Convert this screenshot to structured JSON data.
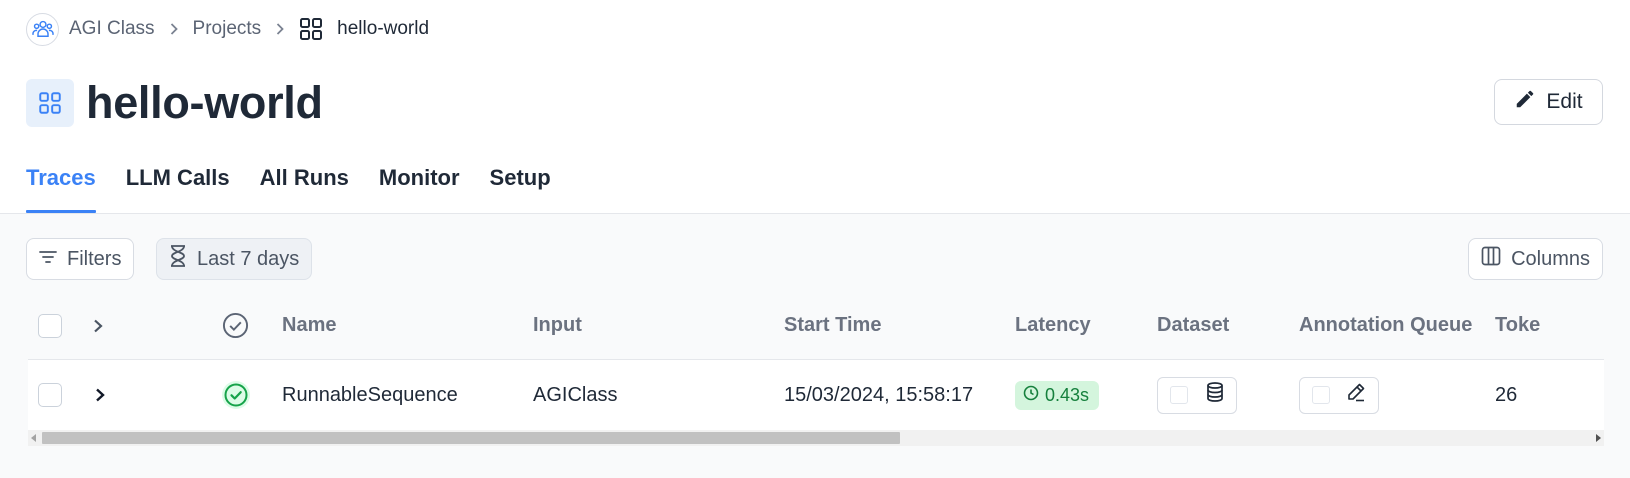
{
  "breadcrumb": {
    "org_icon": "people-icon",
    "org": "AGI Class",
    "projects": "Projects",
    "project_icon": "grid-icon",
    "current": "hello-world"
  },
  "header": {
    "title_icon": "grid-icon",
    "title": "hello-world",
    "edit_label": "Edit",
    "edit_icon": "pencil-icon"
  },
  "tabs": [
    {
      "label": "Traces",
      "active": true
    },
    {
      "label": "LLM Calls",
      "active": false
    },
    {
      "label": "All Runs",
      "active": false
    },
    {
      "label": "Monitor",
      "active": false
    },
    {
      "label": "Setup",
      "active": false
    }
  ],
  "toolbar": {
    "filters_label": "Filters",
    "range_label": "Last 7 days",
    "columns_label": "Columns"
  },
  "table": {
    "columns": [
      "Name",
      "Input",
      "Start Time",
      "Latency",
      "Dataset",
      "Annotation Queue",
      "Toke"
    ],
    "rows": [
      {
        "name": "RunnableSequence",
        "input": "AGIClass",
        "start_time": "15/03/2024, 15:58:17",
        "latency": "0.43s",
        "tokens": "26",
        "status": "success"
      }
    ]
  },
  "colors": {
    "accent": "#3b82f6",
    "success": "#16a34a",
    "latency_bg": "#d4f5dd",
    "latency_text": "#16803d"
  }
}
